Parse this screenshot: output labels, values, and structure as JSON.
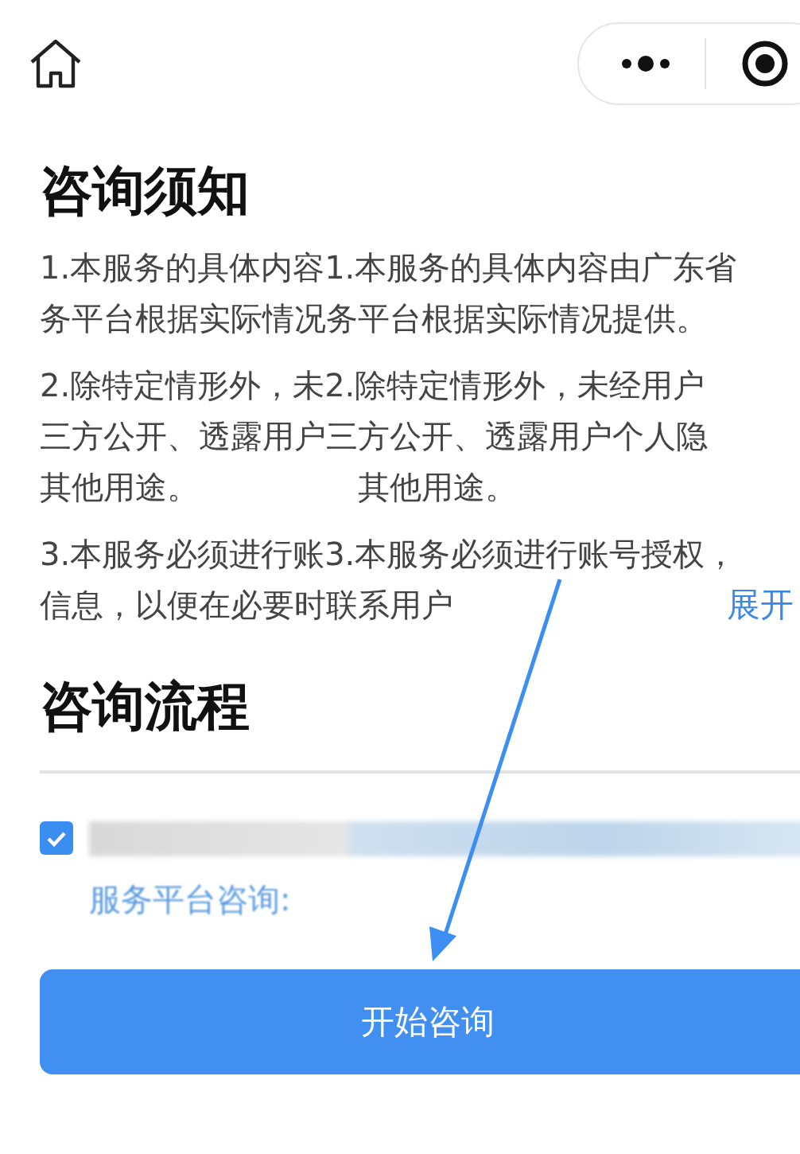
{
  "notice": {
    "title": "咨询须知",
    "paragraphs": [
      {
        "lines": [
          [
            "1.本服务的具体内容1.本服务的具体内容由广东省"
          ],
          [
            "务平台根据实际情况务平台根据实际情况提供。"
          ]
        ]
      },
      {
        "lines": [
          [
            "2.除特定情形外，未2.除特定情形外，未经用户"
          ],
          [
            "三方公开、透露用户三方公开、透露用户个人隐"
          ],
          [
            "其他用途。",
            "其他用途。"
          ]
        ]
      },
      {
        "lines": [
          [
            "3.本服务必须进行账3.本服务必须进行账号授权，"
          ],
          [
            "信息，以便在必要时联系用户"
          ]
        ]
      }
    ],
    "expand_link": "展开"
  },
  "process": {
    "title": "咨询流程",
    "agreement": {
      "checked": true,
      "link": "服务平台咨询:"
    }
  },
  "start_button": "开始咨询"
}
